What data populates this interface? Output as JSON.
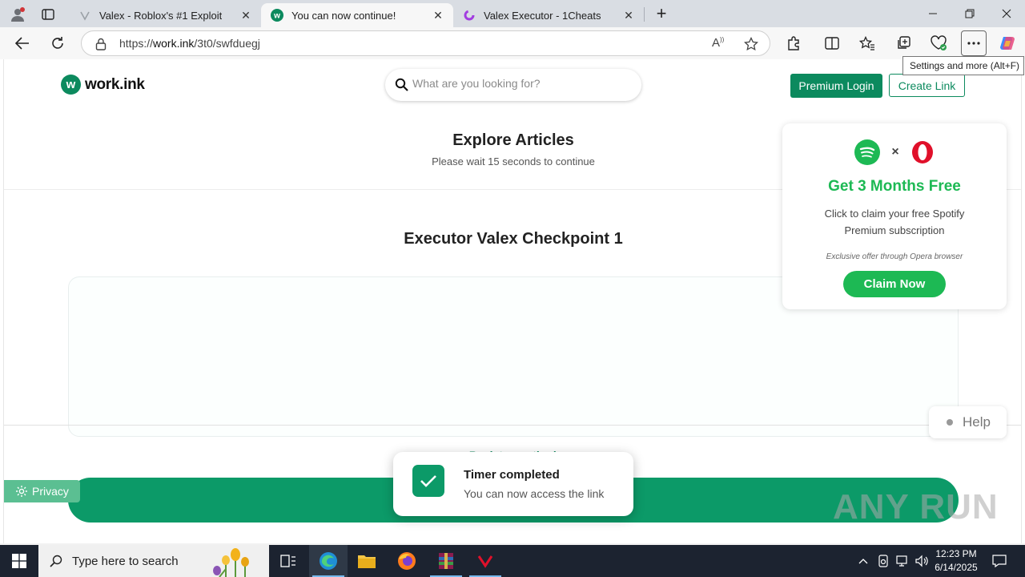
{
  "browser": {
    "tabs": [
      {
        "title": "Valex - Roblox's #1 Exploit",
        "active": false
      },
      {
        "title": "You can now continue!",
        "active": true
      },
      {
        "title": "Valex Executor - 1Cheats",
        "active": false
      }
    ],
    "url_prefix": "https://",
    "url_domain": "work.ink",
    "url_path": "/3t0/swfduegj",
    "tooltip": "Settings and more (Alt+F)"
  },
  "header": {
    "logo_mark": "w",
    "logo_text": "work.ink",
    "search_placeholder": "What are you looking for?",
    "premium_login": "Premium Login",
    "create_link": "Create Link"
  },
  "main": {
    "title": "Explore Articles",
    "wait_text": "Please wait 15 seconds to continue",
    "checkpoint_title": "Executor Valex Checkpoint 1",
    "peek_text": "↑ Back to continuing"
  },
  "ad": {
    "title": "Get 3 Months Free",
    "description": "Click to claim your free Spotify Premium subscription",
    "note": "Exclusive offer through Opera browser",
    "button": "Claim Now",
    "colors": {
      "spotify": "#1db954",
      "opera": "#e0102a"
    }
  },
  "help_label": "Help",
  "privacy_label": "Privacy",
  "toast": {
    "title": "Timer completed",
    "subtitle": "You can now access the link"
  },
  "watermark": "ANY RUN",
  "taskbar": {
    "search_placeholder": "Type here to search",
    "time": "12:23 PM",
    "date": "6/14/2025"
  },
  "colors": {
    "brand": "#0c8a5e",
    "brand_bar": "#0c9a68"
  }
}
